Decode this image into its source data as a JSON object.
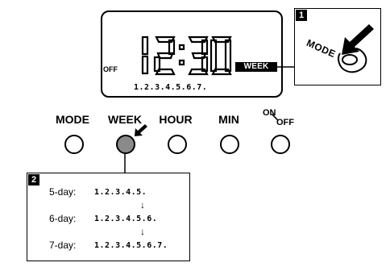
{
  "display": {
    "off_label": "OFF",
    "time": "12:30",
    "week_label": "WEEK",
    "days": "1.2.3.4.5.6.7."
  },
  "callout_1": {
    "badge": "1",
    "button_word": "MODE"
  },
  "buttons": [
    {
      "label": "MODE"
    },
    {
      "label": "WEEK",
      "pressed": true
    },
    {
      "label": "HOUR"
    },
    {
      "label": "MIN"
    },
    {
      "label_top": "ON",
      "label_bottom": "OFF"
    }
  ],
  "callout_2": {
    "badge": "2",
    "rows": [
      {
        "label": "5-day:",
        "days": "1.2.3.4.5."
      },
      {
        "label": "6-day:",
        "days": "1.2.3.4.5.6."
      },
      {
        "label": "7-day:",
        "days": "1.2.3.4.5.6.7."
      }
    ],
    "arrow": "↓"
  },
  "colors": {
    "pressed_button": "#8a8a8a",
    "ink": "#000000",
    "background": "#ffffff"
  },
  "icons": [
    "hand-pressing-button-icon",
    "press-arrow-icon",
    "down-arrow-icon"
  ]
}
